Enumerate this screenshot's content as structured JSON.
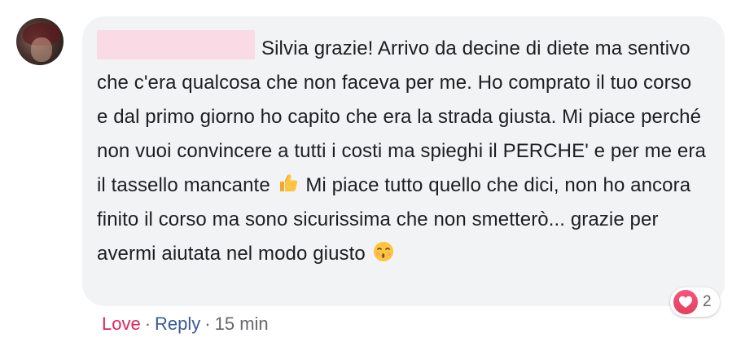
{
  "comment": {
    "text_1": "Silvia grazie! Arrivo da decine di diete ma sentivo che c'era qualcosa che non faceva per me. Ho comprato il tuo corso e dal primo giorno ho capito che era la strada giusta. Mi piace perché non vuoi convincere a tutti i costi ma spieghi il PERCHE' e per me era il tassello mancante",
    "text_2": "Mi piace tutto quello che dici, non ho ancora finito il corso ma sono sicurissima che non smetterò... grazie per avermi aiutata nel modo giusto",
    "emoji_1": "thumbs-up-emoji",
    "emoji_2": "kissing-face-emoji"
  },
  "reactions": {
    "icon": "love-reaction-icon",
    "count": "2",
    "color": "#e4405f"
  },
  "actions": {
    "love_label": "Love",
    "separator": "·",
    "reply_label": "Reply",
    "timestamp": "15 min"
  },
  "colors": {
    "bubble": "#f2f3f5",
    "love": "#e0245e",
    "reply": "#385898",
    "meta": "#65676b",
    "redacted_name": "#fadbe5"
  }
}
